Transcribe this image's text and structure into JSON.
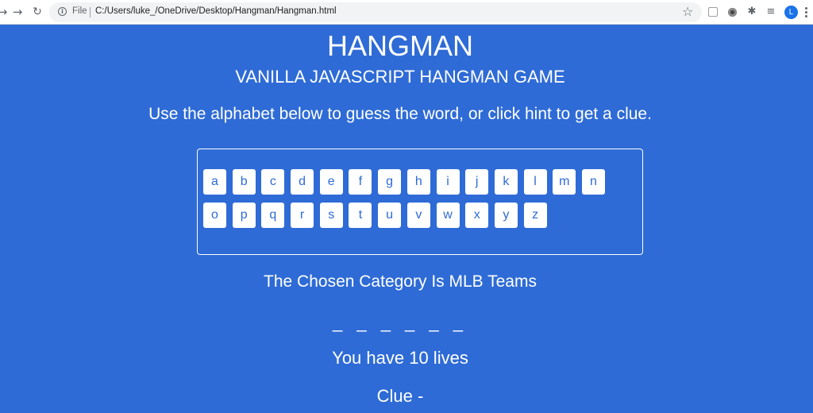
{
  "browser": {
    "scheme_label": "File",
    "url": "C:/Users/luke_/OneDrive/Desktop/Hangman/Hangman.html",
    "avatar_initial": "L",
    "icons": [
      "back-arrow-icon",
      "forward-arrow-icon",
      "reload-icon",
      "info-icon",
      "bookmark-star-icon",
      "extension-icon",
      "media-icon",
      "puzzle-icon",
      "playlist-icon",
      "profile-avatar",
      "kebab-menu-icon"
    ]
  },
  "colors": {
    "background": "#2e6bd6",
    "text": "#ffffff",
    "key_background": "#ffffff",
    "key_text": "#2e6bd6"
  },
  "game": {
    "title": "HANGMAN",
    "subtitle": "VANILLA JAVASCRIPT HANGMAN GAME",
    "instructions": "Use the alphabet below to guess the word, or click hint to get a clue.",
    "alphabet_row1": [
      "a",
      "b",
      "c",
      "d",
      "e",
      "f",
      "g",
      "h",
      "i",
      "j",
      "k",
      "l",
      "m",
      "n"
    ],
    "alphabet_row2": [
      "o",
      "p",
      "q",
      "r",
      "s",
      "t",
      "u",
      "v",
      "w",
      "x",
      "y",
      "z"
    ],
    "category": "The Chosen Category Is MLB Teams",
    "word_blanks": "_ _ _ _ _ _",
    "lives": "You have 10 lives",
    "clue": "Clue -"
  }
}
